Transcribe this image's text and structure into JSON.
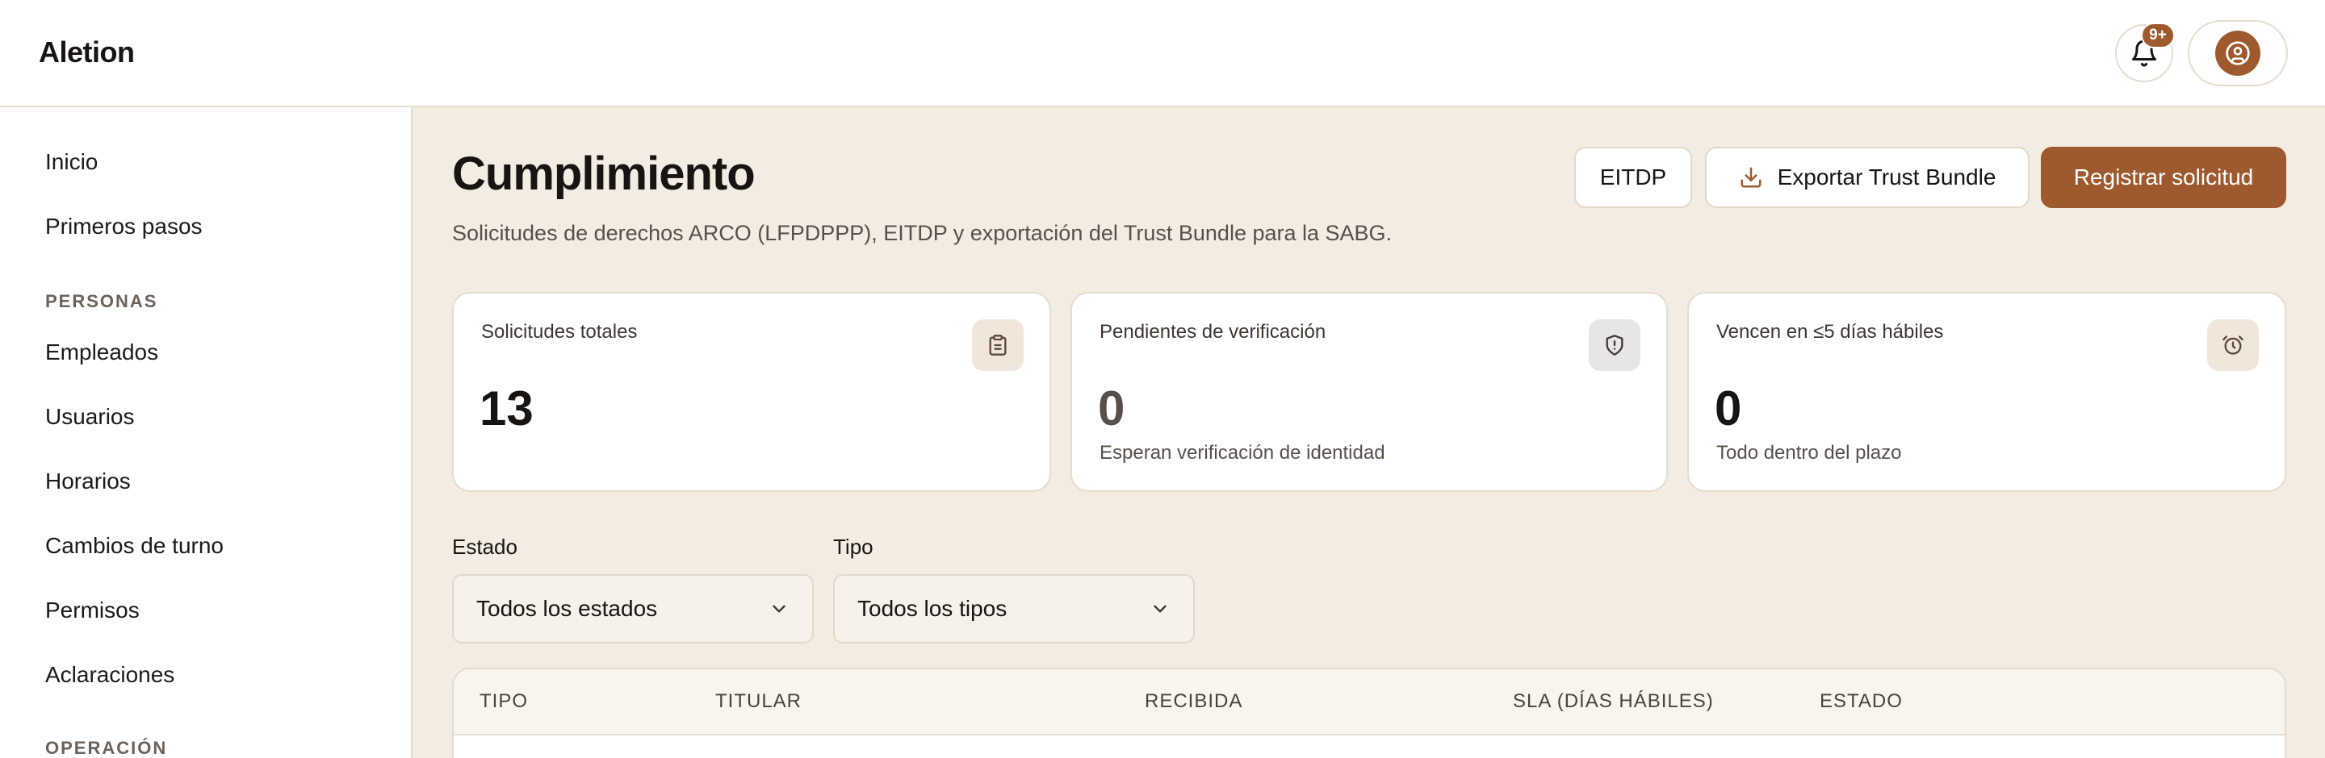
{
  "app": {
    "brand": "Aletion"
  },
  "header": {
    "notifications_badge": "9+"
  },
  "sidebar": {
    "items_top": [
      {
        "label": "Inicio"
      },
      {
        "label": "Primeros pasos"
      }
    ],
    "section_personas": "PERSONAS",
    "items_personas": [
      {
        "label": "Empleados"
      },
      {
        "label": "Usuarios"
      },
      {
        "label": "Horarios"
      },
      {
        "label": "Cambios de turno"
      },
      {
        "label": "Permisos"
      },
      {
        "label": "Aclaraciones"
      }
    ],
    "section_operacion": "OPERACIÓN"
  },
  "page": {
    "title": "Cumplimiento",
    "subtitle": "Solicitudes de derechos ARCO (LFPDPPP), EITDP y exportación del Trust Bundle para la SABG."
  },
  "actions": {
    "eitdp": "EITDP",
    "export": "Exportar Trust Bundle",
    "register": "Registrar solicitud"
  },
  "stats": [
    {
      "label": "Solicitudes totales",
      "value": "13",
      "hint": "",
      "icon": "clipboard-icon"
    },
    {
      "label": "Pendientes de verificación",
      "value": "0",
      "hint": "Esperan verificación de identidad",
      "icon": "shield-alert-icon"
    },
    {
      "label": "Vencen en ≤5 días hábiles",
      "value": "0",
      "hint": "Todo dentro del plazo",
      "icon": "alarm-clock-icon"
    }
  ],
  "filters": {
    "estado": {
      "label": "Estado",
      "value": "Todos los estados"
    },
    "tipo": {
      "label": "Tipo",
      "value": "Todos los tipos"
    }
  },
  "table": {
    "columns": [
      "TIPO",
      "TITULAR",
      "RECIBIDA",
      "SLA (DÍAS HÁBILES)",
      "ESTADO"
    ]
  },
  "colors": {
    "accent": "#9e5a2e",
    "background": "#f3ece2",
    "surface": "#ffffff"
  }
}
